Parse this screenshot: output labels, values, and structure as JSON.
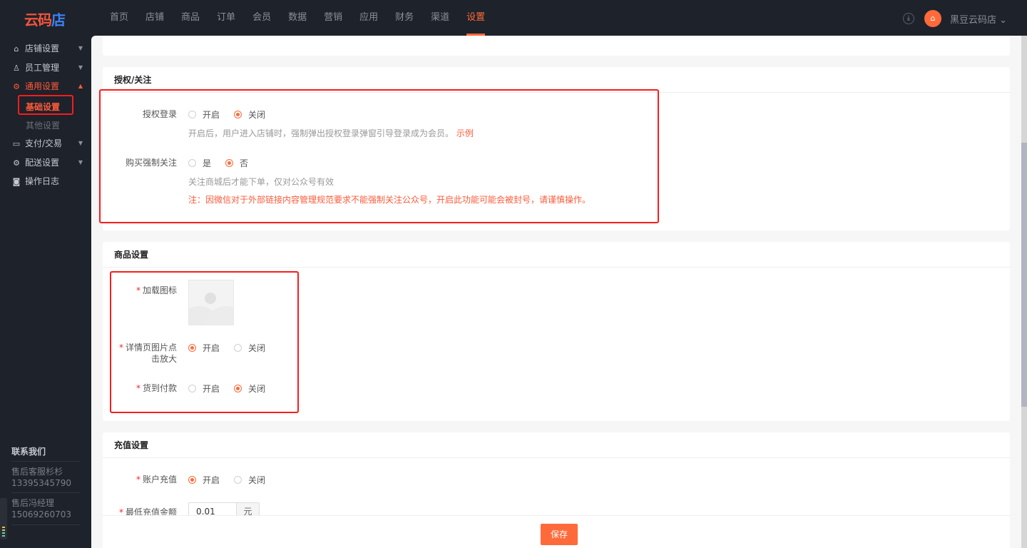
{
  "logo": {
    "text_a": "云码",
    "text_b": "店"
  },
  "nav": [
    "首页",
    "店铺",
    "商品",
    "订单",
    "会员",
    "数据",
    "营销",
    "应用",
    "财务",
    "渠道",
    "设置"
  ],
  "nav_active": "设置",
  "header": {
    "store_name": "黑豆云码店 ⌄",
    "download_icon": "⤓",
    "avatar_icon": "⌂"
  },
  "sidebar": {
    "items": [
      {
        "label": "店铺设置",
        "icon": "⌂"
      },
      {
        "label": "员工管理",
        "icon": "♙"
      },
      {
        "label": "通用设置",
        "icon": "⚙"
      },
      {
        "label": "支付/交易",
        "icon": "▭"
      },
      {
        "label": "配送设置",
        "icon": "⚙"
      },
      {
        "label": "操作日志",
        "icon": "◙"
      }
    ],
    "sub_items": [
      "基础设置",
      "其他设置"
    ],
    "contact_title": "联系我们",
    "contacts": [
      {
        "name": "售后客服杉杉",
        "phone": "13395345790"
      },
      {
        "name": "售后冯经理",
        "phone": "15069260703"
      }
    ]
  },
  "auth": {
    "title": "授权/关注",
    "login_label": "授权登录",
    "login_opts": [
      "开启",
      "关闭"
    ],
    "login_hint": "开启后，用户进入店铺时，强制弹出授权登录弹窗引导登录成为会员。",
    "example": "示例",
    "follow_label": "购买强制关注",
    "follow_opts": [
      "是",
      "否"
    ],
    "follow_hint": "关注商城后才能下单，仅对公众号有效",
    "follow_warn": "注：因微信对于外部链接内容管理规范要求不能强制关注公众号，开启此功能可能会被封号，请谨慎操作。"
  },
  "goods": {
    "title": "商品设置",
    "icon_label": "加载图标",
    "zoom_label_1": "详情页图片点",
    "zoom_label_2": "击放大",
    "zoom_opts": [
      "开启",
      "关闭"
    ],
    "cod_label": "货到付款",
    "cod_opts": [
      "开启",
      "关闭"
    ]
  },
  "recharge": {
    "title": "充值设置",
    "account_label": "账户充值",
    "account_opts": [
      "开启",
      "关闭"
    ],
    "min_label": "最低充值金额",
    "min_value": "0.01",
    "unit": "元"
  },
  "footer": {
    "save": "保存"
  },
  "required_mark": "*"
}
